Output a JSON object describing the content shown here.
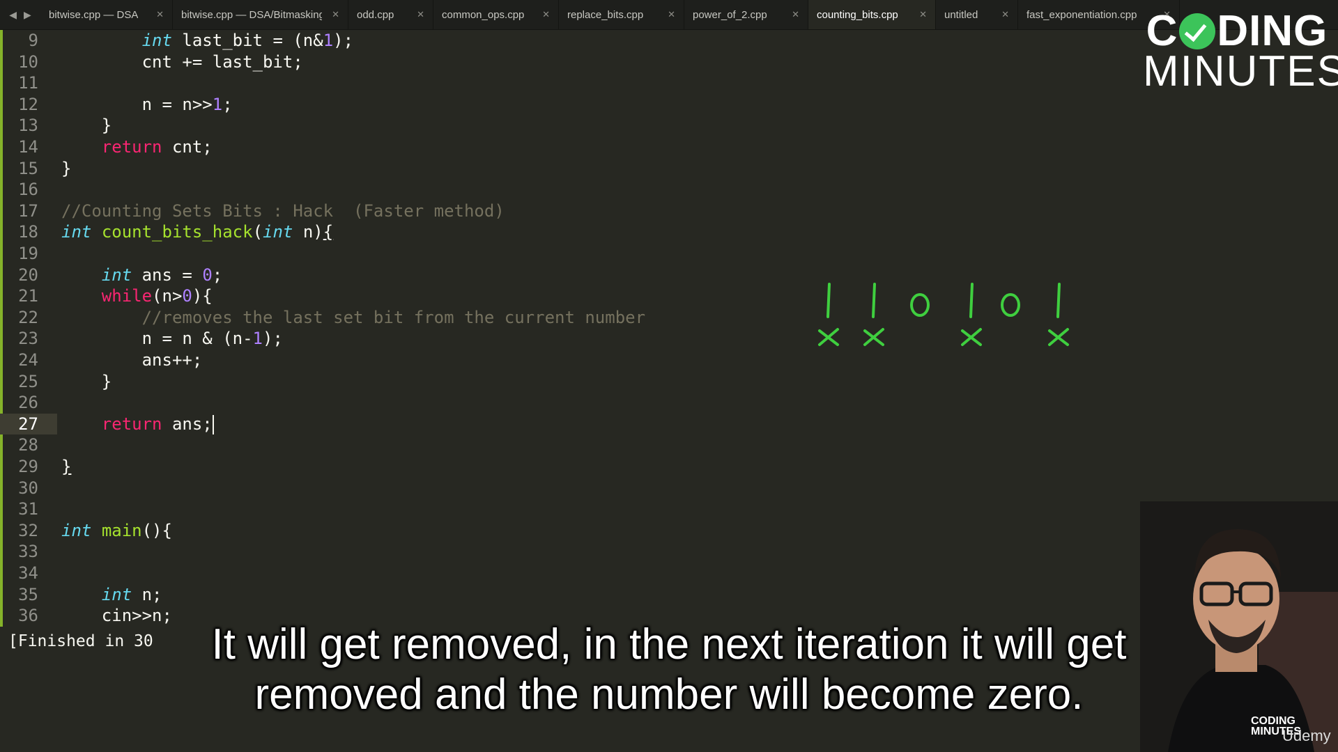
{
  "tabs": [
    {
      "label": "bitwise.cpp — DSA",
      "width": 190,
      "active": false
    },
    {
      "label": "bitwise.cpp — DSA/Bitmasking",
      "width": 252,
      "active": false
    },
    {
      "label": "odd.cpp",
      "width": 122,
      "active": false
    },
    {
      "label": "common_ops.cpp",
      "width": 180,
      "active": false
    },
    {
      "label": "replace_bits.cpp",
      "width": 180,
      "active": false
    },
    {
      "label": "power_of_2.cpp",
      "width": 178,
      "active": false
    },
    {
      "label": "counting_bits.cpp",
      "width": 183,
      "active": true
    },
    {
      "label": "untitled",
      "width": 118,
      "active": false
    },
    {
      "label": "fast_exponentiation.cpp",
      "width": 232,
      "active": false
    }
  ],
  "code_lines": [
    {
      "n": "9",
      "html": "        <span class='ty'>int</span> last_bit = (n&amp;<span class='num'>1</span>);"
    },
    {
      "n": "10",
      "html": "        cnt += last_bit;"
    },
    {
      "n": "11",
      "html": ""
    },
    {
      "n": "12",
      "html": "        n = n&gt;&gt;<span class='num'>1</span>;"
    },
    {
      "n": "13",
      "html": "    }"
    },
    {
      "n": "14",
      "html": "    <span class='kw'>return</span> cnt;"
    },
    {
      "n": "15",
      "html": "}"
    },
    {
      "n": "16",
      "html": ""
    },
    {
      "n": "17",
      "html": "<span class='cm'>//Counting Sets Bits : Hack  (Faster method)</span>"
    },
    {
      "n": "18",
      "html": "<span class='ty'>int</span> <span class='fn'>count_bits_hack</span>(<span class='ty'>int</span> n)<span class='ul'>{</span>"
    },
    {
      "n": "19",
      "html": ""
    },
    {
      "n": "20",
      "html": "    <span class='ty'>int</span> ans = <span class='num'>0</span>;"
    },
    {
      "n": "21",
      "html": "    <span class='kw'>while</span>(n&gt;<span class='num'>0</span>){"
    },
    {
      "n": "22",
      "html": "        <span class='cm'>//removes the last set bit from the current number</span>"
    },
    {
      "n": "23",
      "html": "        n = n &amp; (n-<span class='num'>1</span>);"
    },
    {
      "n": "24",
      "html": "        ans++;"
    },
    {
      "n": "25",
      "html": "    }"
    },
    {
      "n": "26",
      "html": ""
    },
    {
      "n": "27",
      "html": "    <span class='kw'>return</span> ans;<span class='caret'></span>",
      "current": true
    },
    {
      "n": "28",
      "html": ""
    },
    {
      "n": "29",
      "html": "<span class='ul'>}</span>"
    },
    {
      "n": "30",
      "html": ""
    },
    {
      "n": "31",
      "html": ""
    },
    {
      "n": "32",
      "html": "<span class='ty'>int</span> <span class='fn'>main</span>(){"
    },
    {
      "n": "33",
      "html": ""
    },
    {
      "n": "34",
      "html": ""
    },
    {
      "n": "35",
      "html": "    <span class='ty'>int</span> n;"
    },
    {
      "n": "36",
      "html": "    cin&gt;&gt;n;"
    }
  ],
  "annotation": {
    "digits": [
      "1",
      "1",
      "0",
      "1",
      "0",
      "1"
    ],
    "crossed": [
      true,
      true,
      false,
      true,
      false,
      true
    ],
    "color": "#3fcf3f"
  },
  "output": {
    "text": "[Finished in 30"
  },
  "subtitle": {
    "line1": "It will get removed, in the next iteration it will get",
    "line2": "removed and the number will become zero."
  },
  "logo": {
    "line1_pre": "C",
    "line1_post": "DING",
    "line2": "MINUTES"
  },
  "watermark": {
    "small_logo_line1": "CODING",
    "small_logo_line2": "MINUTES",
    "udemy": "Udemy"
  },
  "colors": {
    "background": "#272822",
    "keyword": "#f92672",
    "type": "#66d9ef",
    "function": "#a6e22e",
    "number": "#ae81ff",
    "comment": "#75715e",
    "accent_green": "#3cc45a"
  }
}
